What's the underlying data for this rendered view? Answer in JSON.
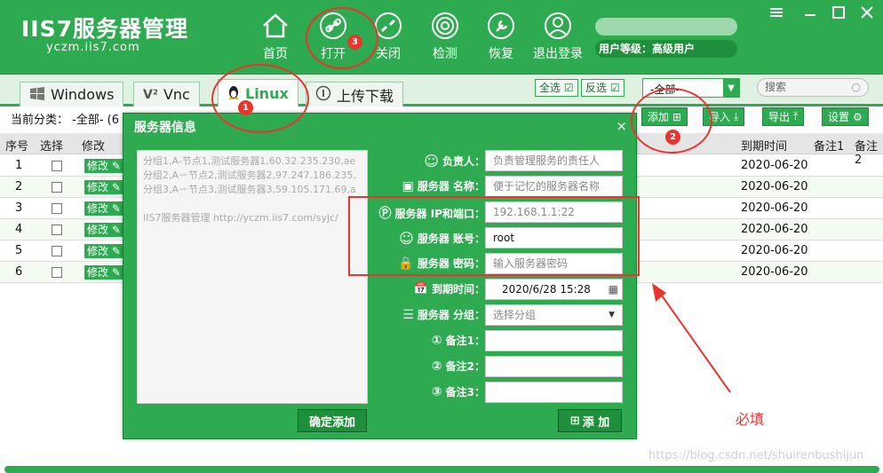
{
  "app": {
    "title": "IIS7服务器管理",
    "subtitle": "yczm.iis7.com"
  },
  "nav": [
    {
      "label": "首页",
      "icon": "home-icon"
    },
    {
      "label": "打开",
      "icon": "link-icon"
    },
    {
      "label": "关闭",
      "icon": "unlink-icon"
    },
    {
      "label": "检测",
      "icon": "radar-icon"
    },
    {
      "label": "恢复",
      "icon": "wrench-icon"
    },
    {
      "label": "退出登录",
      "icon": "user-icon"
    }
  ],
  "user": {
    "level": "用户等级：高级用户"
  },
  "tabs": [
    {
      "label": "Windows",
      "icon": "windows-icon"
    },
    {
      "label": "Vnc",
      "icon": "vnc-icon"
    },
    {
      "label": "Linux",
      "icon": "linux-icon"
    },
    {
      "label": "上传下载",
      "icon": "upload-icon"
    }
  ],
  "toolbar": {
    "select_all": "全选",
    "invert": "反选",
    "category_selected": "-全部-",
    "search_placeholder": "搜索",
    "add": "添加",
    "import": "导入",
    "export": "导出",
    "settings": "设置",
    "current_category": "当前分类： -全部- (6"
  },
  "table": {
    "headers": {
      "index": "序号",
      "select": "选择",
      "edit": "修改",
      "expire": "到期时间",
      "note1": "备注1",
      "note2": "备注2"
    },
    "edit_label": "修改",
    "rows": [
      {
        "index": "1",
        "expire": "2020-06-20"
      },
      {
        "index": "2",
        "expire": "2020-06-20"
      },
      {
        "index": "3",
        "expire": "2020-06-20"
      },
      {
        "index": "4",
        "expire": "2020-06-20"
      },
      {
        "index": "5",
        "expire": "2020-06-20"
      },
      {
        "index": "6",
        "expire": "2020-06-20"
      }
    ]
  },
  "modal": {
    "title": "服务器信息",
    "close": "×",
    "batch_lines": [
      "分组1,A-节点1,测试服务器1,60.32.235.230,ae",
      "分组2,A－节点2,测试服务器2,97.247.186.235,",
      "分组3,A－节点3,测试服务器3,59.105.171.69,a",
      "",
      "IIS7服务器管理 http://yczm.iis7.com/syjc/"
    ],
    "confirm_add": "确定添加",
    "add": "添 加",
    "fields": [
      {
        "label": "负责人：",
        "value": "负责管理服务的责任人",
        "filled": false
      },
      {
        "label": "服务器 名称：",
        "value": "便于记忆的服务器名称",
        "filled": false
      },
      {
        "label": "服务器 IP和端口：",
        "value": "192.168.1.1:22",
        "filled": false
      },
      {
        "label": "服务器 账号：",
        "value": "root",
        "filled": true
      },
      {
        "label": "服务器 密码：",
        "value": "输入服务器密码",
        "filled": false
      },
      {
        "label": "到期时间：",
        "value": "2020/6/28 15:28",
        "filled": true
      },
      {
        "label": "服务器 分组：",
        "value": "选择分组",
        "filled": false
      },
      {
        "label": "备注1：",
        "value": "",
        "filled": false
      },
      {
        "label": "备注2：",
        "value": "",
        "filled": false
      },
      {
        "label": "备注3：",
        "value": "",
        "filled": false
      }
    ]
  },
  "annotations": {
    "badge1": "1",
    "badge2": "2",
    "badge3": "3",
    "required_note": "必填",
    "watermark": "https://blog.csdn.net/shuirenbushijun"
  }
}
